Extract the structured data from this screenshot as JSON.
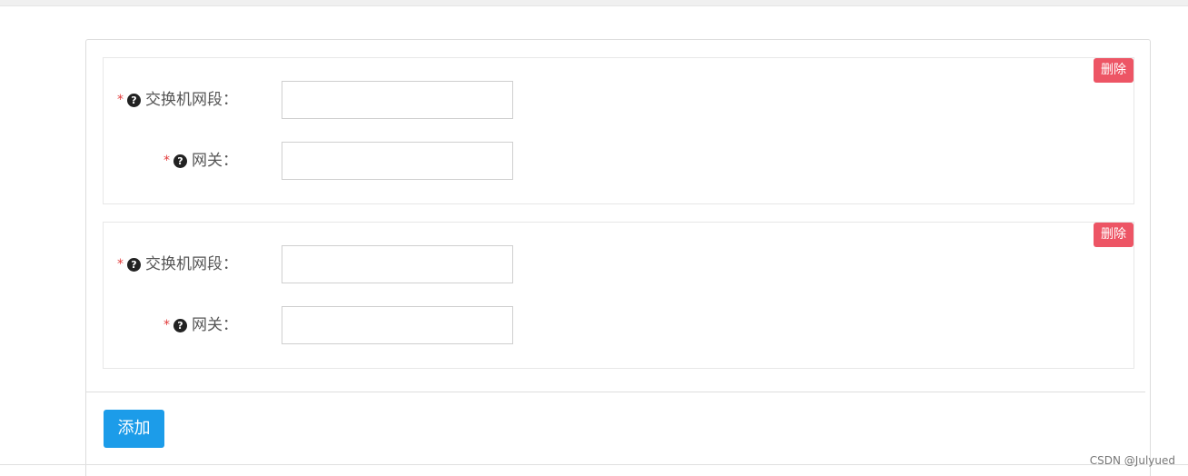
{
  "groups": [
    {
      "delete_label": "删除",
      "fields": [
        {
          "required_mark": "*",
          "help_icon": "?",
          "label": "交换机网段：",
          "value": ""
        },
        {
          "required_mark": "*",
          "help_icon": "?",
          "label": "网关：",
          "value": ""
        }
      ]
    },
    {
      "delete_label": "删除",
      "fields": [
        {
          "required_mark": "*",
          "help_icon": "?",
          "label": "交换机网段：",
          "value": ""
        },
        {
          "required_mark": "*",
          "help_icon": "?",
          "label": "网关：",
          "value": ""
        }
      ]
    }
  ],
  "add_label": "添加",
  "watermark": "CSDN @Julyued",
  "colors": {
    "delete_button": "#ed5565",
    "add_button": "#1c9ce9",
    "required_mark": "#e23b3b"
  }
}
